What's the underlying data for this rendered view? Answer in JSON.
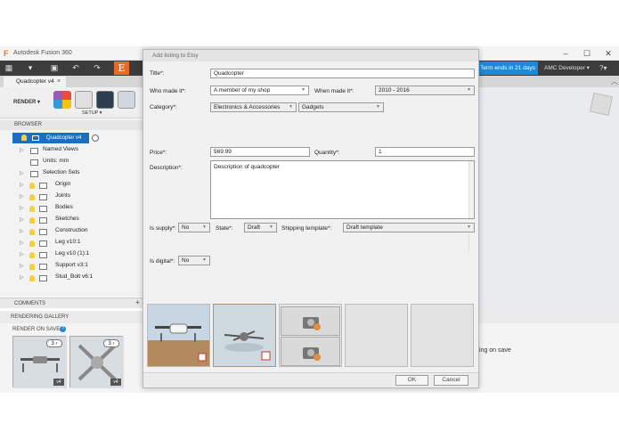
{
  "app": {
    "title": "Autodesk Fusion 360",
    "logo_glyph": "F",
    "minimize": "–",
    "maximize": "☐",
    "close": "✕"
  },
  "toolbar": {
    "grid_icon": "▦",
    "file_icon": "▾",
    "save_icon": "▣",
    "undo_icon": "↶",
    "redo_icon": "↷",
    "etsy_label": "E",
    "term_badge": "Term ends in 21 days",
    "user_menu": "AMC Developer ▾",
    "help": "?▾"
  },
  "document": {
    "tab_label": "Quadcopter v4",
    "close": "×"
  },
  "ribbon": {
    "render_label": "RENDER ▾",
    "setup_label": "SETUP ▾"
  },
  "browser": {
    "header": "BROWSER",
    "root": "Quadcopter v4",
    "items": [
      {
        "label": "Named Views"
      },
      {
        "label": "Units: mm"
      },
      {
        "label": "Selection Sets"
      },
      {
        "label": "Origin"
      },
      {
        "label": "Joints"
      },
      {
        "label": "Bodies"
      },
      {
        "label": "Sketches"
      },
      {
        "label": "Construction"
      },
      {
        "label": "Leg v10:1"
      },
      {
        "label": "Leg v10 (1):1"
      },
      {
        "label": "Support v3:1"
      },
      {
        "label": "Stud_Bolt v6:1"
      }
    ]
  },
  "comments": {
    "label": "COMMENTS",
    "plus": "+"
  },
  "gallery": {
    "label": "RENDERING GALLERY",
    "render_on_save": "RENDER ON SAVE",
    "render_on_save_right": "ing on save",
    "thumbs": [
      {
        "badge": "3 ›",
        "version": "v4"
      },
      {
        "badge": "3 ›",
        "version": "v4"
      }
    ]
  },
  "dialog": {
    "title": "Add listing to Etsy",
    "title_label": "Title*:",
    "title_value": "Quadcopter",
    "who_made_label": "Who made it*:",
    "who_made_value": "A member of my shop",
    "when_made_label": "When made it*:",
    "when_made_value": "2010 - 2016",
    "category_label": "Category*:",
    "category_value": "Electronics & Accessories",
    "subcategory_value": "Gadgets",
    "price_label": "Price*:",
    "price_value": "569.99",
    "quantity_label": "Quantity*:",
    "quantity_value": "1",
    "description_label": "Description*:",
    "description_value": "Description of quadcopter",
    "supply_label": "Is supply*:",
    "supply_value": "No",
    "state_label": "State*:",
    "state_value": "Draft",
    "shipping_label": "Shipping template*:",
    "shipping_value": "Draft template",
    "digital_label": "Is digital*:",
    "digital_value": "No",
    "ok_label": "OK",
    "cancel_label": "Cancel"
  },
  "colors": {
    "accent_blue": "#1c8ad6",
    "etsy_orange": "#e86a2a",
    "selected_photo": "#8fc0e6"
  }
}
